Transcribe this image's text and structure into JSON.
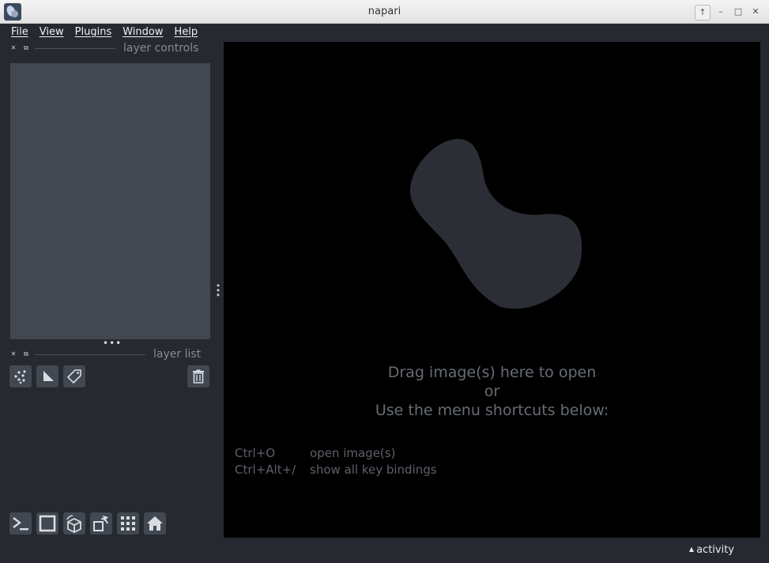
{
  "window": {
    "title": "napari",
    "controls": [
      "↑",
      "–",
      "□",
      "✕"
    ]
  },
  "menu": {
    "items": [
      {
        "key": "F",
        "rest": "ile"
      },
      {
        "key": "V",
        "rest": "iew"
      },
      {
        "key": "P",
        "rest": "lugins"
      },
      {
        "key": "W",
        "rest": "indow"
      },
      {
        "key": "H",
        "rest": "elp"
      }
    ]
  },
  "docks": {
    "layer_controls_title": "layer controls",
    "layer_list_title": "layer list"
  },
  "layer_buttons": [
    "new-points-icon",
    "new-shapes-icon",
    "new-labels-icon",
    "delete-layer-icon"
  ],
  "viewer_buttons": [
    "console-icon",
    "ndisplay-icon",
    "roll-icon",
    "transpose-icon",
    "grid-icon",
    "home-icon"
  ],
  "canvas": {
    "hint_line1": "Drag image(s) here to open",
    "hint_line2": "or",
    "hint_line3": "Use the menu shortcuts below:",
    "shortcuts": [
      {
        "keys": "Ctrl+O",
        "action": "open image(s)"
      },
      {
        "keys": "Ctrl+Alt+/",
        "action": "show all key bindings"
      }
    ]
  },
  "status": {
    "activity_label": "activity"
  },
  "colors": {
    "background": "#262930",
    "panel": "#414851",
    "canvas": "#000000",
    "logo_blob": "#2b2e35"
  }
}
